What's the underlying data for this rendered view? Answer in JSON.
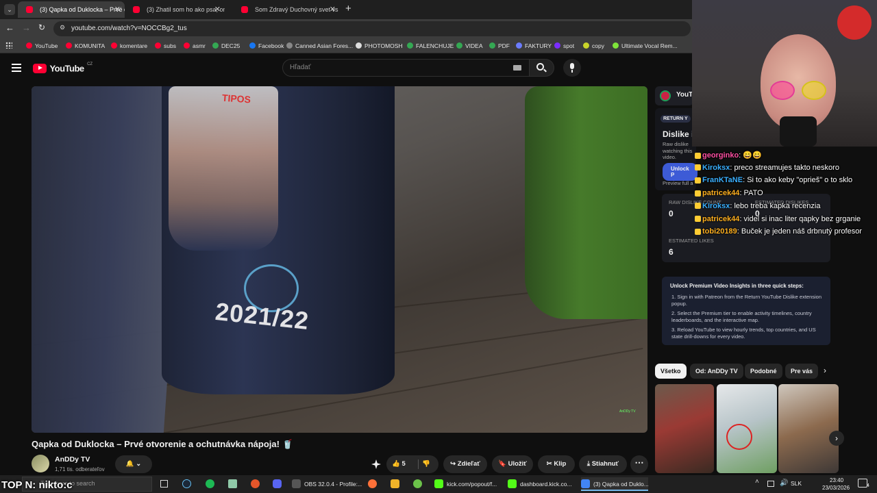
{
  "tabs": [
    {
      "label": "(3) Qapka od Duklocka – Prvé o",
      "active": true
    },
    {
      "label": "(3) Zhatil som ho ako psa, on m",
      "active": false
    },
    {
      "label": "Som Zdravý Duchovný svet vs /",
      "active": false
    }
  ],
  "address": {
    "url": "youtube.com/watch?v=NOCCBg2_tus"
  },
  "bookmarks": [
    {
      "label": "YouTube",
      "color": "#ff0033"
    },
    {
      "label": "KOMUNITA",
      "color": "#ff0033"
    },
    {
      "label": "komentare",
      "color": "#ff0033"
    },
    {
      "label": "subs",
      "color": "#ff0033"
    },
    {
      "label": "asmr",
      "color": "#ff0033"
    },
    {
      "label": "DEC25",
      "color": "#34a853"
    },
    {
      "label": "Facebook",
      "color": "#1877f2"
    },
    {
      "label": "Canned Asian Fores...",
      "color": "#888888"
    },
    {
      "label": "PHOTOMOSH",
      "color": "#dddddd"
    },
    {
      "label": "FALENCHUJE",
      "color": "#34a853"
    },
    {
      "label": "VIDEA",
      "color": "#34a853"
    },
    {
      "label": "PDF",
      "color": "#34a853"
    },
    {
      "label": "FAKTURY",
      "color": "#6b7cff"
    },
    {
      "label": "spot",
      "color": "#7b2cff"
    },
    {
      "label": "copy",
      "color": "#c9d42a"
    },
    {
      "label": "Ultimate Vocal Rem...",
      "color": "#7ee33a"
    }
  ],
  "youtube": {
    "logo_text": "YouTube",
    "logo_sup": "CZ",
    "search_placeholder": "Hľadať"
  },
  "video": {
    "can_text": "2021/22",
    "brand_text": "TIPOS",
    "watermark": "AnDDy TV"
  },
  "meta": {
    "title": "Qapka od Duklocka – Prvé otvorenie a ochutnávka nápoja! 🥤",
    "channel": "AnDDy TV",
    "subscribers": "1,71 tis. odberateľov",
    "likes": "5",
    "share_label": "Zdieľať",
    "save_label": "Uložiť",
    "clip_label": "Klip",
    "download_label": "Stiahnuť"
  },
  "extension": {
    "header": "YouT",
    "badge": "RETURN Y",
    "title": "Dislike i",
    "desc_line1": "Raw dislike",
    "desc_line2": "watching this video.",
    "unlock_btn": "Unlock P",
    "preview": "Preview full a",
    "raw_label": "RAW DISLIKE COUNT",
    "raw_value": "0",
    "est_dislikes_label": "ESTIMATED DISLIKES",
    "est_dislikes_value": "0",
    "est_likes_label": "ESTIMATED LIKES",
    "est_likes_value": "6",
    "premium_title": "Unlock Premium Video Insights in three quick steps:",
    "steps": [
      "Sign in with Patreon from the Return YouTube Dislike extension popup.",
      "Select the Premium tier to enable activity timelines, country leaderboards, and the interactive map.",
      "Reload YouTube to view hourly trends, top countries, and US state drill-downs for every video."
    ]
  },
  "chips": [
    "Všetko",
    "Od: AnDDy TV",
    "Podobné",
    "Pre vás"
  ],
  "chat": [
    {
      "user": "georginko",
      "msg": ": 😄😄",
      "color": "#ff4fa3"
    },
    {
      "user": "Kiroksx",
      "msg": ": preco streamujes takto neskoro",
      "color": "#3ab0ff"
    },
    {
      "user": "FranKTaNE",
      "msg": ": Si to ako keby \"oprieš\" o to sklo",
      "color": "#3ab0ff"
    },
    {
      "user": "patricek44",
      "msg": ": PATO",
      "color": "#ffb020"
    },
    {
      "user": "Kiroksx",
      "msg": ": lebo treba kapka recenzia",
      "color": "#3ab0ff"
    },
    {
      "user": "patricek44",
      "msg": ": videl si inac liter qapky bez grganie",
      "color": "#ffb020"
    },
    {
      "user": "tobi20189",
      "msg": ": Buček je jeden náš drbnutý profesor",
      "color": "#ffb020"
    }
  ],
  "overlay_text": "TOP N: nikto:c",
  "taskbar": {
    "search_placeholder": "Type here to search",
    "items": [
      {
        "label": "OBS 32.0.4 - Profile:...",
        "color": "#555555"
      },
      {
        "label": "kick.com/popout/f...",
        "color": "#53fc18"
      },
      {
        "label": "dashboard.kick.co...",
        "color": "#53fc18"
      },
      {
        "label": "(3) Qapka od Duklo...",
        "color": "#4285f4"
      }
    ],
    "lang": "SLK",
    "time": "23:40",
    "date": "23/03/2026",
    "notifications": "4"
  }
}
